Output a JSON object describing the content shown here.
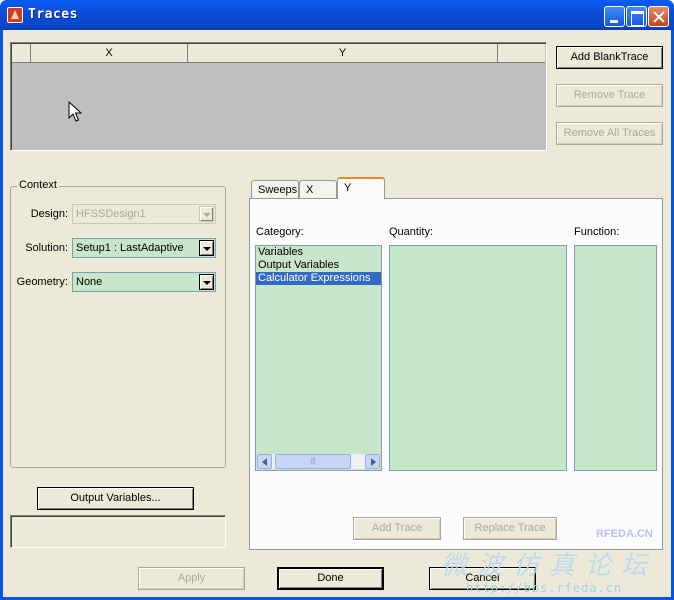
{
  "window": {
    "title": "Traces"
  },
  "grid": {
    "columns": [
      "",
      "X",
      "Y",
      ""
    ]
  },
  "actions": {
    "add_blank_trace": "Add BlankTrace",
    "remove_trace": "Remove Trace",
    "remove_all_traces": "Remove All Traces"
  },
  "context": {
    "title": "Context",
    "design_label": "Design:",
    "design_value": "HFSSDesign1",
    "solution_label": "Solution:",
    "solution_value": "Setup1 : LastAdaptive",
    "geometry_label": "Geometry:",
    "geometry_value": "None",
    "output_variables_button": "Output Variables..."
  },
  "tabs": [
    {
      "label": "Sweeps"
    },
    {
      "label": "X"
    },
    {
      "label": "Y"
    }
  ],
  "panel": {
    "category_label": "Category:",
    "quantity_label": "Quantity:",
    "function_label": "Function:",
    "category_items": [
      "Variables",
      "Output Variables",
      "Calculator Expressions"
    ],
    "selected_category": "Calculator Expressions",
    "add_trace": "Add Trace",
    "replace_trace": "Replace Trace"
  },
  "footer": {
    "apply": "Apply",
    "done": "Done",
    "cancel": "Cancel"
  },
  "watermark": {
    "site": "RFEDA.CN",
    "brand": "微波仿真论坛",
    "url": "http://bbs.rfeda.cn"
  },
  "colors": {
    "title_bar": "#0a4fd8",
    "list_background": "#c8e6c9",
    "selection": "#316ac5",
    "dialog_face": "#ece9d8"
  },
  "icons": [
    "app-icon",
    "minimize-icon",
    "maximize-icon",
    "close-icon",
    "mouse-cursor-icon"
  ]
}
